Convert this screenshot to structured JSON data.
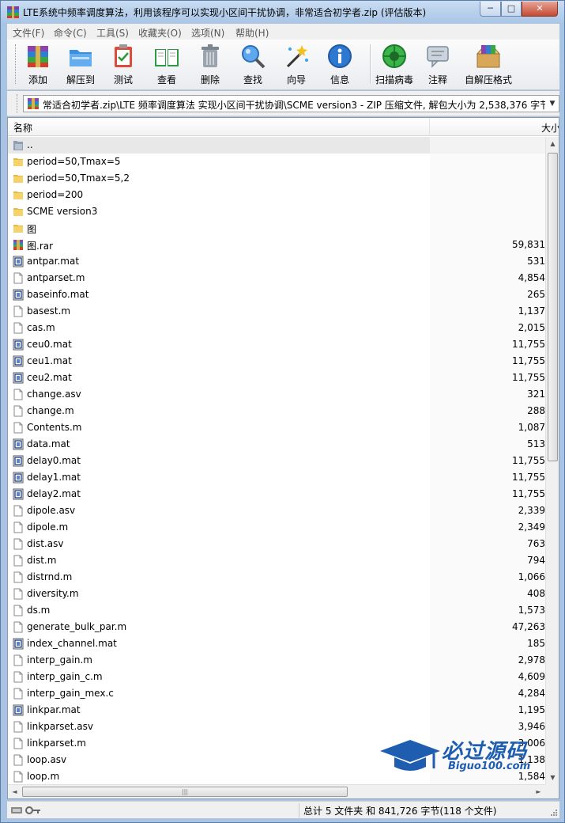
{
  "window": {
    "title": "LTE系统中频率调度算法，利用该程序可以实现小区间干扰协调，非常适合初学者.zip (评估版本)",
    "min_glyph": "─",
    "max_glyph": "□",
    "close_glyph": "✕"
  },
  "menu": [
    "文件(F)",
    "命令(C)",
    "工具(S)",
    "收藏夹(O)",
    "选项(N)",
    "帮助(H)"
  ],
  "toolbar": {
    "add": "添加",
    "extract": "解压到",
    "test": "测试",
    "view": "查看",
    "delete": "删除",
    "find": "查找",
    "wizard": "向导",
    "info": "信息",
    "virus": "扫描病毒",
    "comment": "注释",
    "sfx": "自解压格式"
  },
  "address": {
    "path": "常适合初学者.zip\\LTE 频率调度算法 实现小区间干扰协调\\SCME version3 - ZIP 压缩文件, 解包大小为 2,538,376 字节",
    "dropdown_glyph": "▼"
  },
  "columns": {
    "name": "名称",
    "size": "大小",
    "sort_glyph": "^"
  },
  "files": [
    {
      "name": "..",
      "size": "",
      "icon": "up-folder-icon"
    },
    {
      "name": "period=50,Tmax=5",
      "size": "",
      "icon": "folder-icon"
    },
    {
      "name": "period=50,Tmax=5,2",
      "size": "",
      "icon": "folder-icon"
    },
    {
      "name": "period=200",
      "size": "",
      "icon": "folder-icon"
    },
    {
      "name": "SCME version3",
      "size": "",
      "icon": "folder-icon"
    },
    {
      "name": "图",
      "size": "",
      "icon": "folder-icon"
    },
    {
      "name": "图.rar",
      "size": "59,831",
      "icon": "rar-icon"
    },
    {
      "name": "antpar.mat",
      "size": "531",
      "icon": "mat-icon"
    },
    {
      "name": "antparset.m",
      "size": "4,854",
      "icon": "file-icon"
    },
    {
      "name": "baseinfo.mat",
      "size": "265",
      "icon": "mat-icon"
    },
    {
      "name": "basest.m",
      "size": "1,137",
      "icon": "file-icon"
    },
    {
      "name": "cas.m",
      "size": "2,015",
      "icon": "file-icon"
    },
    {
      "name": "ceu0.mat",
      "size": "11,755",
      "icon": "mat-icon"
    },
    {
      "name": "ceu1.mat",
      "size": "11,755",
      "icon": "mat-icon"
    },
    {
      "name": "ceu2.mat",
      "size": "11,755",
      "icon": "mat-icon"
    },
    {
      "name": "change.asv",
      "size": "321",
      "icon": "file-icon"
    },
    {
      "name": "change.m",
      "size": "288",
      "icon": "file-icon"
    },
    {
      "name": "Contents.m",
      "size": "1,087",
      "icon": "file-icon"
    },
    {
      "name": "data.mat",
      "size": "513",
      "icon": "mat-icon"
    },
    {
      "name": "delay0.mat",
      "size": "11,755",
      "icon": "mat-icon"
    },
    {
      "name": "delay1.mat",
      "size": "11,755",
      "icon": "mat-icon"
    },
    {
      "name": "delay2.mat",
      "size": "11,755",
      "icon": "mat-icon"
    },
    {
      "name": "dipole.asv",
      "size": "2,339",
      "icon": "file-icon"
    },
    {
      "name": "dipole.m",
      "size": "2,349",
      "icon": "file-icon"
    },
    {
      "name": "dist.asv",
      "size": "763",
      "icon": "file-icon"
    },
    {
      "name": "dist.m",
      "size": "794",
      "icon": "file-icon"
    },
    {
      "name": "distrnd.m",
      "size": "1,066",
      "icon": "file-icon"
    },
    {
      "name": "diversity.m",
      "size": "408",
      "icon": "file-icon"
    },
    {
      "name": "ds.m",
      "size": "1,573",
      "icon": "file-icon"
    },
    {
      "name": "generate_bulk_par.m",
      "size": "47,263",
      "icon": "file-icon"
    },
    {
      "name": "index_channel.mat",
      "size": "185",
      "icon": "mat-icon"
    },
    {
      "name": "interp_gain.m",
      "size": "2,978",
      "icon": "file-icon"
    },
    {
      "name": "interp_gain_c.m",
      "size": "4,609",
      "icon": "file-icon"
    },
    {
      "name": "interp_gain_mex.c",
      "size": "4,284",
      "icon": "file-icon"
    },
    {
      "name": "linkpar.mat",
      "size": "1,195",
      "icon": "mat-icon"
    },
    {
      "name": "linkparset.asv",
      "size": "3,946",
      "icon": "file-icon"
    },
    {
      "name": "linkparset.m",
      "size": "3,006",
      "icon": "file-icon"
    },
    {
      "name": "loop.asv",
      "size": "1,138",
      "icon": "file-icon"
    },
    {
      "name": "loop.m",
      "size": "1,584",
      "icon": "file-icon"
    }
  ],
  "scroll": {
    "up": "▲",
    "down": "▼",
    "left": "◄",
    "right": "►",
    "grip": "|||"
  },
  "status": {
    "summary": "总计 5 文件夹 和 841,726 字节(118 个文件)"
  },
  "watermark": {
    "cn": "必过源码",
    "en": "Biguo100.com"
  }
}
